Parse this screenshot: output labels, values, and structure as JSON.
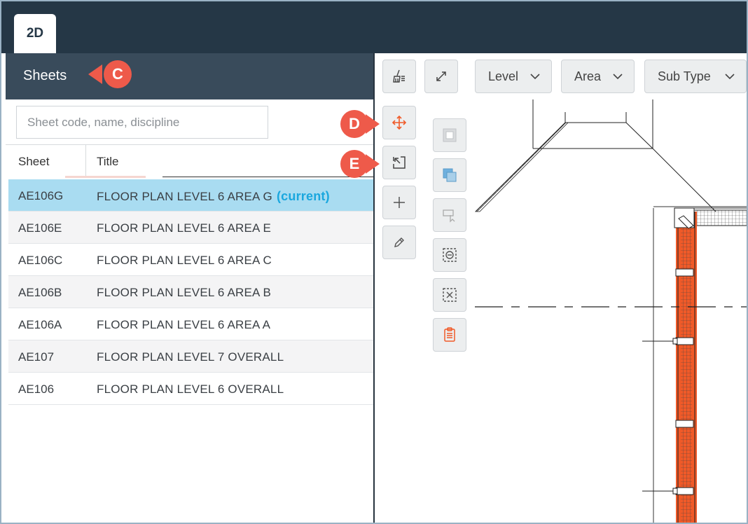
{
  "app": {
    "tab_label": "2D"
  },
  "sheets_panel": {
    "title": "Sheets",
    "search_placeholder": "Sheet code, name, discipline",
    "columns": {
      "sheet": "Sheet",
      "title": "Title"
    },
    "rows": [
      {
        "code": "AE106G",
        "title": "FLOOR PLAN LEVEL 6 AREA G",
        "current_label": "(current)",
        "selected": true
      },
      {
        "code": "AE106E",
        "title": "FLOOR PLAN LEVEL 6 AREA E"
      },
      {
        "code": "AE106C",
        "title": "FLOOR PLAN LEVEL 6 AREA C"
      },
      {
        "code": "AE106B",
        "title": "FLOOR PLAN LEVEL 6 AREA B"
      },
      {
        "code": "AE106A",
        "title": "FLOOR PLAN LEVEL 6 AREA A"
      },
      {
        "code": "AE107",
        "title": "FLOOR PLAN LEVEL 7 OVERALL"
      },
      {
        "code": "AE106",
        "title": "FLOOR PLAN LEVEL 6 OVERALL"
      }
    ]
  },
  "viewer_toolbar": {
    "filters": [
      {
        "label": "Level"
      },
      {
        "label": "Area"
      },
      {
        "label": "Sub Type"
      }
    ],
    "tools_left": [
      "move-icon",
      "select-region-icon",
      "plus-icon",
      "pencil-icon"
    ],
    "tools_right": [
      "square-outline-icon",
      "overlay-icon",
      "select-shape-icon",
      "zoom-out-region-icon",
      "clear-region-icon",
      "clipboard-icon"
    ],
    "top_tools": [
      "broom-icon",
      "expand-icon"
    ]
  },
  "callouts": {
    "c": "C",
    "d": "D",
    "e": "E"
  },
  "colors": {
    "header_dark": "#253746",
    "panel_header": "#394b5b",
    "selected_row": "#a9dcf1",
    "current_text": "#1aa7de",
    "callout": "#ee5a4a",
    "accent_orange": "#f05a28"
  }
}
